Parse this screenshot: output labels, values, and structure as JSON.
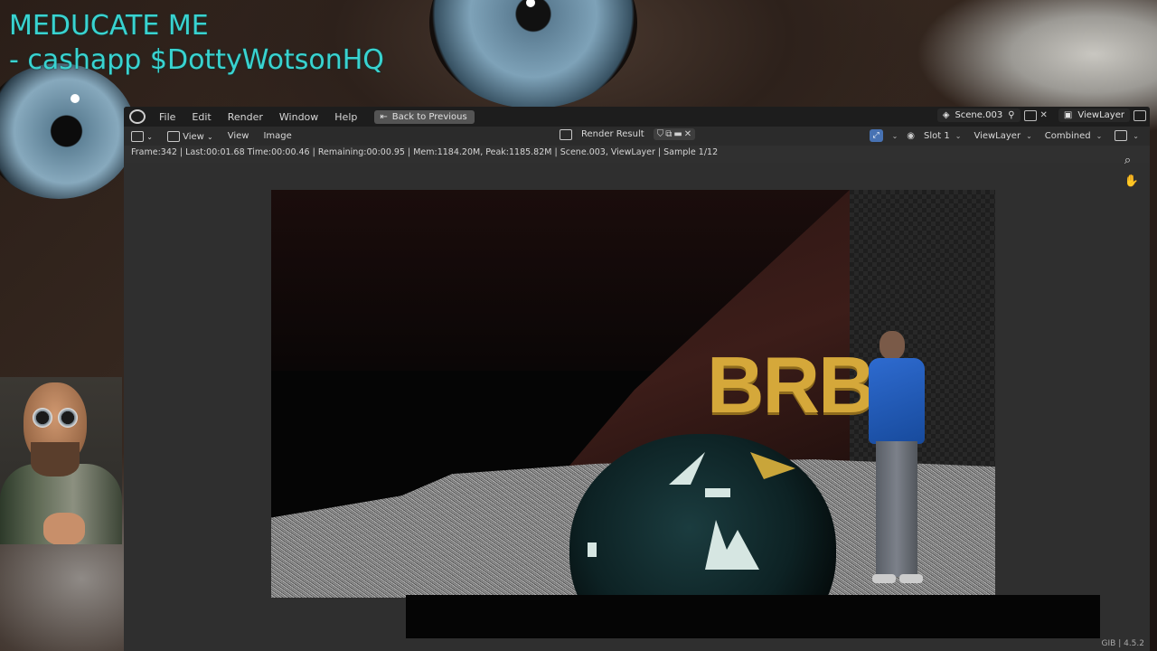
{
  "overlay": {
    "line1": "MEDUCATE ME",
    "line2": "- cashapp $DottyWotsonHQ"
  },
  "topbar": {
    "menus": [
      "File",
      "Edit",
      "Render",
      "Window",
      "Help"
    ],
    "back_button": "Back to Previous",
    "scene": "Scene.003",
    "view_layer": "ViewLayer"
  },
  "image_header": {
    "view_menu": "View",
    "menus": [
      "View",
      "Image"
    ],
    "render_result": "Render Result",
    "slot": "Slot 1",
    "view_layer": "ViewLayer",
    "pass": "Combined"
  },
  "status": {
    "text": "Frame:342 | Last:00:01.68 Time:00:00.46 | Remaining:00:00.95 | Mem:1184.20M, Peak:1185.82M | Scene.003, ViewLayer | Sample 1/12"
  },
  "render": {
    "overlay_text": "BRB"
  },
  "footer": {
    "version": "GIB | 4.5.2"
  },
  "colors": {
    "overlay_text": "#39d3d0",
    "brb_text": "#d5a83a",
    "blender_accent": "#4772b3"
  }
}
